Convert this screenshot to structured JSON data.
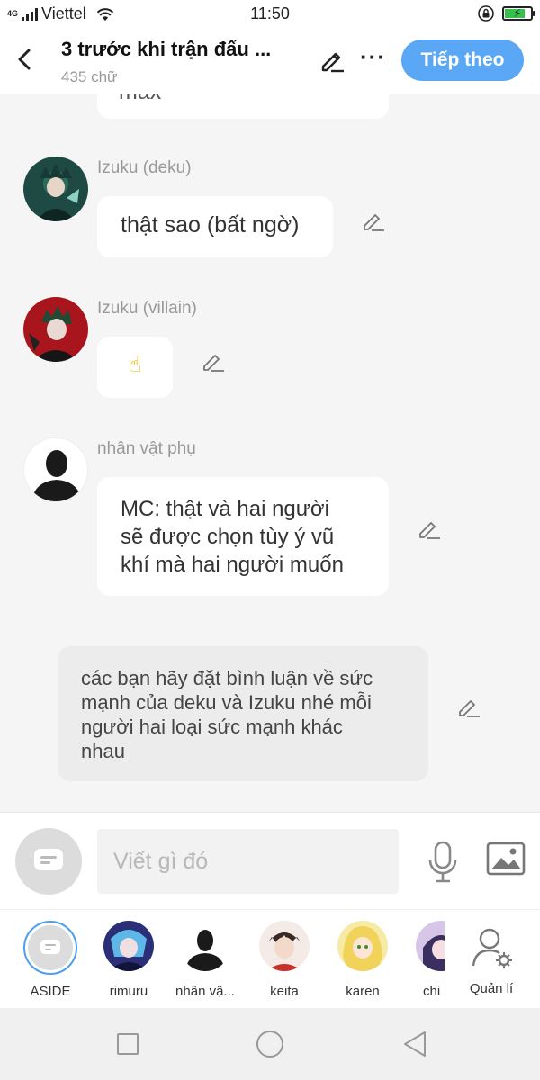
{
  "status_bar": {
    "network": "4G",
    "carrier": "Viettel",
    "time": "11:50",
    "battery_percent": 80,
    "icons": [
      "signal-icon",
      "wifi-icon",
      "orientation-lock-icon",
      "battery-icon"
    ]
  },
  "header": {
    "title": "3 trước khi trận đấu ...",
    "subtitle": "435 chữ",
    "next_label": "Tiếp theo",
    "icons": [
      "back-arrow-icon",
      "pencil-icon",
      "more-icon"
    ]
  },
  "chat": {
    "partial_text": "max",
    "messages": [
      {
        "speaker": "Izuku (deku)",
        "text": "thật sao (bất ngờ)"
      },
      {
        "speaker": "Izuku (villain)",
        "text": "☝"
      },
      {
        "speaker": "nhân vật phụ",
        "text_lines": [
          "MC: thật và hai người",
          "sẽ được chọn tùy ý vũ",
          "khí mà hai người muốn"
        ]
      }
    ],
    "narration_lines": [
      "các bạn hãy đặt bình luận về sức",
      "mạnh của deku và Izuku nhé mỗi",
      "người hai loại sức mạnh khác",
      "nhau"
    ]
  },
  "input": {
    "placeholder": "Viết gì đó",
    "value": "",
    "icons": [
      "message-icon",
      "microphone-icon",
      "image-icon"
    ]
  },
  "characters": {
    "items": [
      {
        "label": "ASIDE"
      },
      {
        "label": "rimuru"
      },
      {
        "label": "nhân vậ..."
      },
      {
        "label": "keita"
      },
      {
        "label": "karen"
      },
      {
        "label": "chi"
      }
    ],
    "manage_label": "Quản lí"
  },
  "colors": {
    "accent": "#5aa8f5",
    "selected_border": "#4b9ff0",
    "background": "#f5f5f5",
    "bubble": "#ffffff",
    "narration_bg": "#ececec"
  }
}
